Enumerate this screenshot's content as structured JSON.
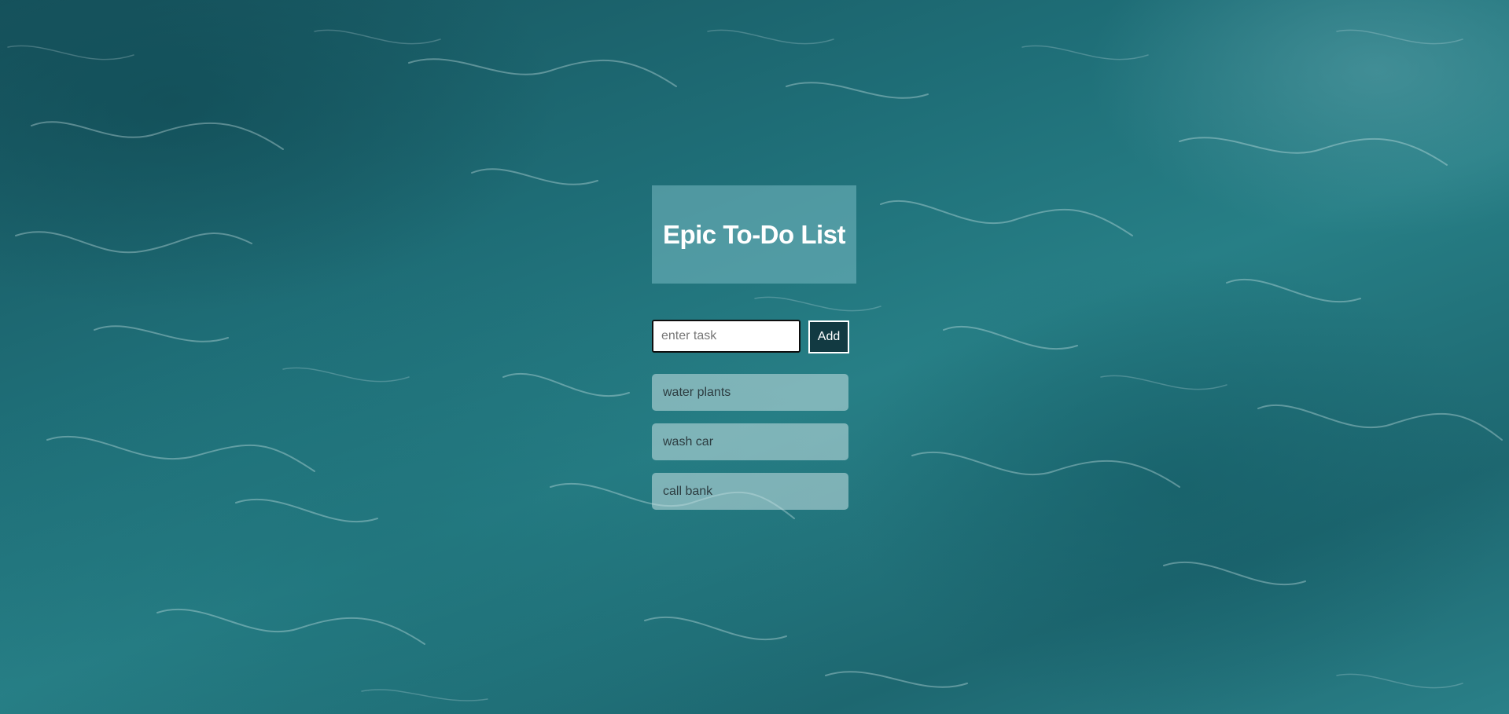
{
  "app": {
    "title": "Epic To-Do List"
  },
  "form": {
    "input_value": "",
    "input_placeholder": "enter task",
    "add_label": "Add"
  },
  "tasks": [
    {
      "label": "water plants"
    },
    {
      "label": "wash car"
    },
    {
      "label": "call bank"
    }
  ],
  "colors": {
    "background": "#1f6b73",
    "title_card": "#78b9c3",
    "add_button": "#123a42",
    "task_item": "#c8e1e4",
    "title_text": "#ffffff"
  }
}
